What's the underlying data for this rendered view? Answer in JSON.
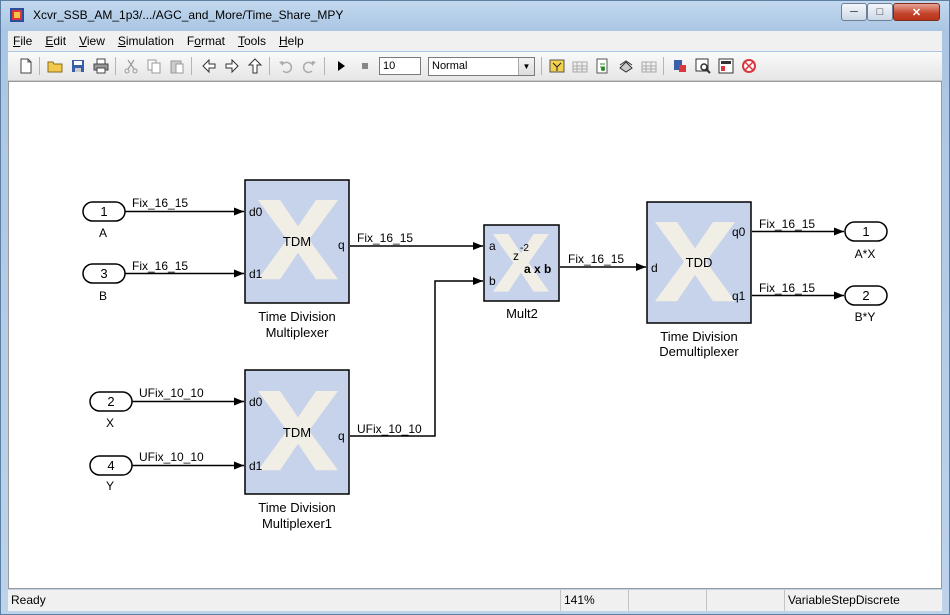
{
  "window": {
    "title": "Xcvr_SSB_AM_1p3/.../AGC_and_More/Time_Share_MPY"
  },
  "menu": [
    {
      "label": "File",
      "accel": "F",
      "rest": "ile"
    },
    {
      "label": "Edit",
      "accel": "E",
      "rest": "dit"
    },
    {
      "label": "View",
      "accel": "V",
      "rest": "iew"
    },
    {
      "label": "Simulation",
      "accel": "S",
      "rest": "imulation"
    },
    {
      "label": "Format",
      "accel": "o",
      "pre": "F",
      "rest": "rmat"
    },
    {
      "label": "Tools",
      "accel": "T",
      "rest": "ools"
    },
    {
      "label": "Help",
      "accel": "H",
      "rest": "elp"
    }
  ],
  "toolbar": {
    "stop_time": "10",
    "sim_mode": "Normal",
    "icons": [
      "new-model-icon",
      "open-icon",
      "save-icon",
      "print-icon",
      "cut-icon",
      "copy-icon",
      "paste-icon",
      "back-icon",
      "forward-icon",
      "up-icon",
      "undo-icon",
      "redo-icon",
      "start-simulation-icon",
      "stop-simulation-icon",
      "build-icon",
      "update-icon",
      "refresh-icon",
      "library-browser-icon",
      "model-explorer-icon",
      "debug-icon",
      "model-advisor-icon",
      "profiler-icon",
      "sysgen-icon"
    ]
  },
  "diagram": {
    "inports": [
      {
        "num": "1",
        "label": "A",
        "signal": "Fix_16_15"
      },
      {
        "num": "3",
        "label": "B",
        "signal": "Fix_16_15"
      },
      {
        "num": "2",
        "label": "X",
        "signal": "UFix_10_10"
      },
      {
        "num": "4",
        "label": "Y",
        "signal": "UFix_10_10"
      }
    ],
    "outports": [
      {
        "num": "1",
        "label": "A*X",
        "signal": "Fix_16_15"
      },
      {
        "num": "2",
        "label": "B*Y",
        "signal": "Fix_16_15"
      }
    ],
    "tdm1": {
      "name": "TDM",
      "caption1": "Time Division",
      "caption2": "Multiplexer",
      "in0": "d0",
      "in1": "d1",
      "out": "q",
      "out_signal": "Fix_16_15"
    },
    "tdm2": {
      "name": "TDM",
      "caption1": "Time Division",
      "caption2": "Multiplexer1",
      "in0": "d0",
      "in1": "d1",
      "out": "q",
      "out_signal": "UFix_10_10"
    },
    "mult": {
      "caption": "Mult2",
      "in_a": "a",
      "in_b": "b",
      "latency": "z",
      "latency_exp": "-2",
      "op": "a x b",
      "out_signal": "Fix_16_15"
    },
    "tdd": {
      "name": "TDD",
      "caption1": "Time Division",
      "caption2": "Demultiplexer",
      "in": "d",
      "out0": "q0",
      "out1": "q1"
    }
  },
  "status": {
    "ready": "Ready",
    "zoom": "141%",
    "solver": "VariableStepDiscrete"
  }
}
